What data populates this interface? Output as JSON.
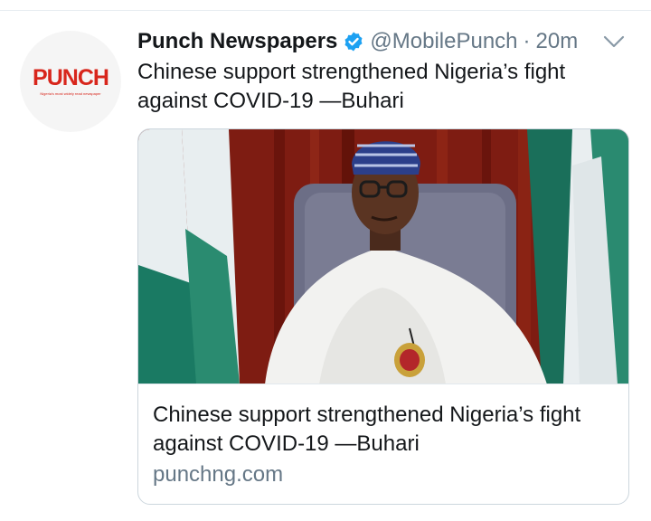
{
  "tweet": {
    "author": {
      "name": "Punch Newspapers",
      "handle": "@MobilePunch",
      "avatar_logo_text": "PUNCH",
      "avatar_tagline": "Nigeria's most widely read newspaper"
    },
    "separator": "·",
    "time": "20m",
    "text": "Chinese support strengthened Nigeria’s fight against COVID-19 —Buhari",
    "card": {
      "title": "Chinese support strengthened Nigeria’s fight against COVID-19 —Buhari",
      "domain": "punchng.com"
    }
  },
  "icons": {
    "verified": "verified-badge-icon",
    "caret": "chevron-down-icon"
  },
  "colors": {
    "verified_blue": "#1da1f2",
    "muted_text": "#657786",
    "punch_red": "#d8261c",
    "flag_green": "#008751"
  }
}
